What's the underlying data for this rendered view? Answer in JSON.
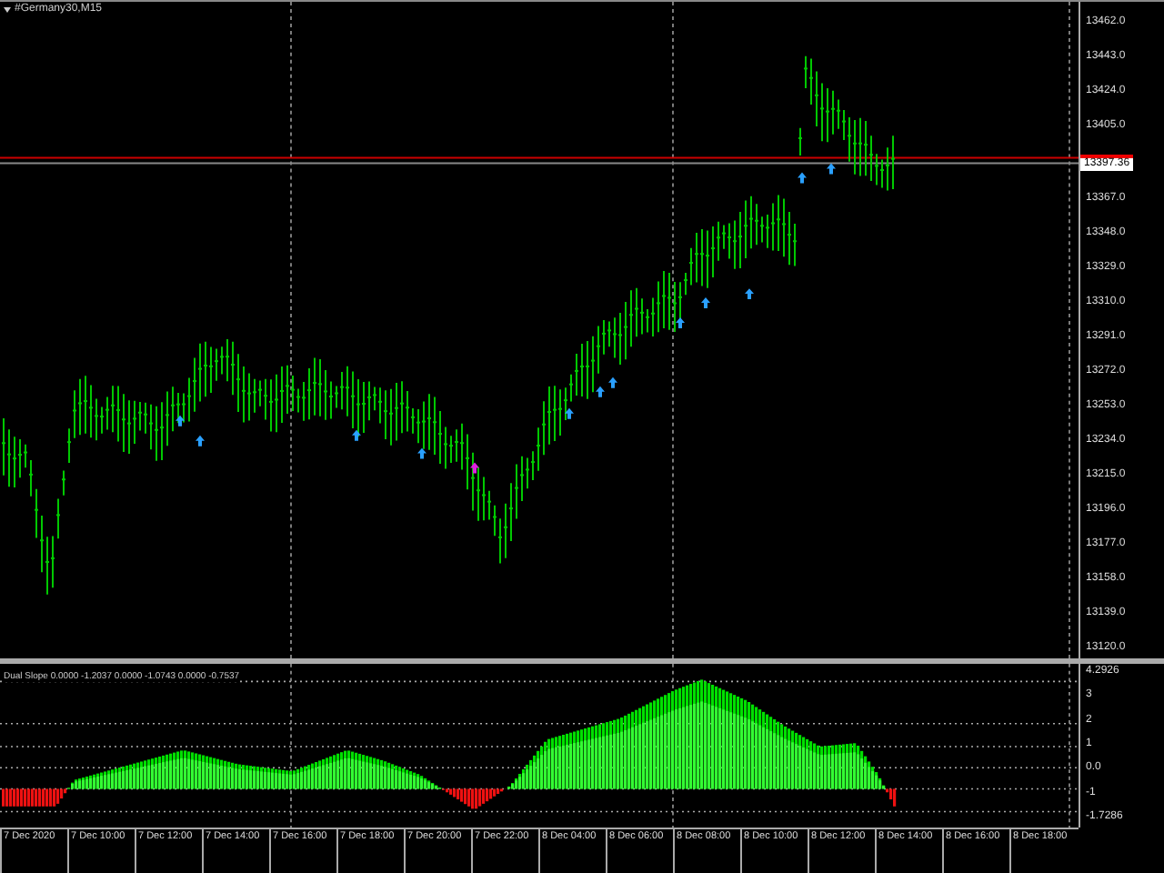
{
  "window": {
    "title": "#Germany30,M15"
  },
  "price_axis": {
    "labels": [
      "13462.0",
      "13443.0",
      "13424.0",
      "13405.0",
      "13367.0",
      "13348.0",
      "13329.0",
      "13310.0",
      "13291.0",
      "13272.0",
      "13253.0",
      "13234.0",
      "13215.0",
      "13196.0",
      "13177.0",
      "13158.0",
      "13139.0",
      "13120.0"
    ],
    "current_price": "13397.36"
  },
  "indicator": {
    "title": "Dual Slope 0.0000 -1.2037 0.0000 -1.0743 0.0000 -0.7537",
    "axis_labels": [
      "4.2926",
      "3",
      "2",
      "1",
      "0.0",
      "-1",
      "-1.7286"
    ]
  },
  "time_axis": {
    "labels": [
      "7 Dec 2020",
      "7 Dec 10:00",
      "7 Dec 12:00",
      "7 Dec 14:00",
      "7 Dec 16:00",
      "7 Dec 18:00",
      "7 Dec 20:00",
      "7 Dec 22:00",
      "8 Dec 04:00",
      "8 Dec 06:00",
      "8 Dec 08:00",
      "8 Dec 10:00",
      "8 Dec 12:00",
      "8 Dec 14:00",
      "8 Dec 16:00",
      "8 Dec 18:00"
    ]
  }
}
